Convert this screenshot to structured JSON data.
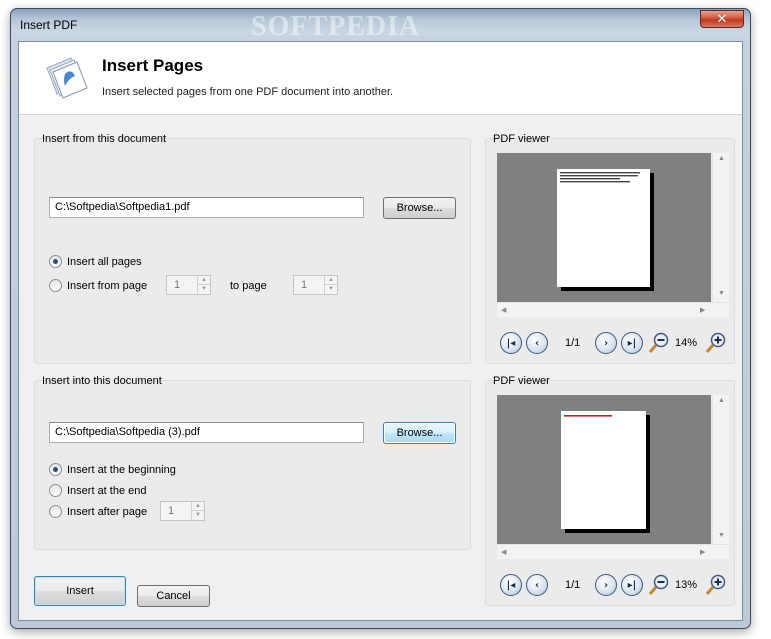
{
  "window": {
    "title": "Insert PDF",
    "watermark": "SOFTPEDIA",
    "close_glyph": "✕"
  },
  "header": {
    "title": "Insert Pages",
    "subtitle": "Insert selected pages from one PDF document into another.",
    "icon": "pdf-pages-icon"
  },
  "source": {
    "group_label": "Insert from this document",
    "path": "C:\\Softpedia\\Softpedia1.pdf",
    "browse_label": "Browse...",
    "options": {
      "all": "Insert all pages",
      "range": "Insert from page"
    },
    "from_page": "1",
    "to_label": "to page",
    "to_page": "1",
    "selected": "all"
  },
  "target": {
    "group_label": "Insert into this document",
    "path": "C:\\Softpedia\\Softpedia (3).pdf",
    "browse_label": "Browse...",
    "options": {
      "beginning": "Insert at the beginning",
      "end": "Insert at the end",
      "after": "Insert after page"
    },
    "after_page": "1",
    "selected": "beginning"
  },
  "viewer_top": {
    "label": "PDF viewer",
    "page_indicator": "1/1",
    "zoom": "14%"
  },
  "viewer_bottom": {
    "label": "PDF viewer",
    "page_indicator": "1/1",
    "zoom": "13%"
  },
  "footer": {
    "insert_label": "Insert",
    "cancel_label": "Cancel"
  },
  "colors": {
    "accent": "#3c7fb1",
    "viewer_bg": "#808080",
    "close_red": "#c0391f"
  }
}
